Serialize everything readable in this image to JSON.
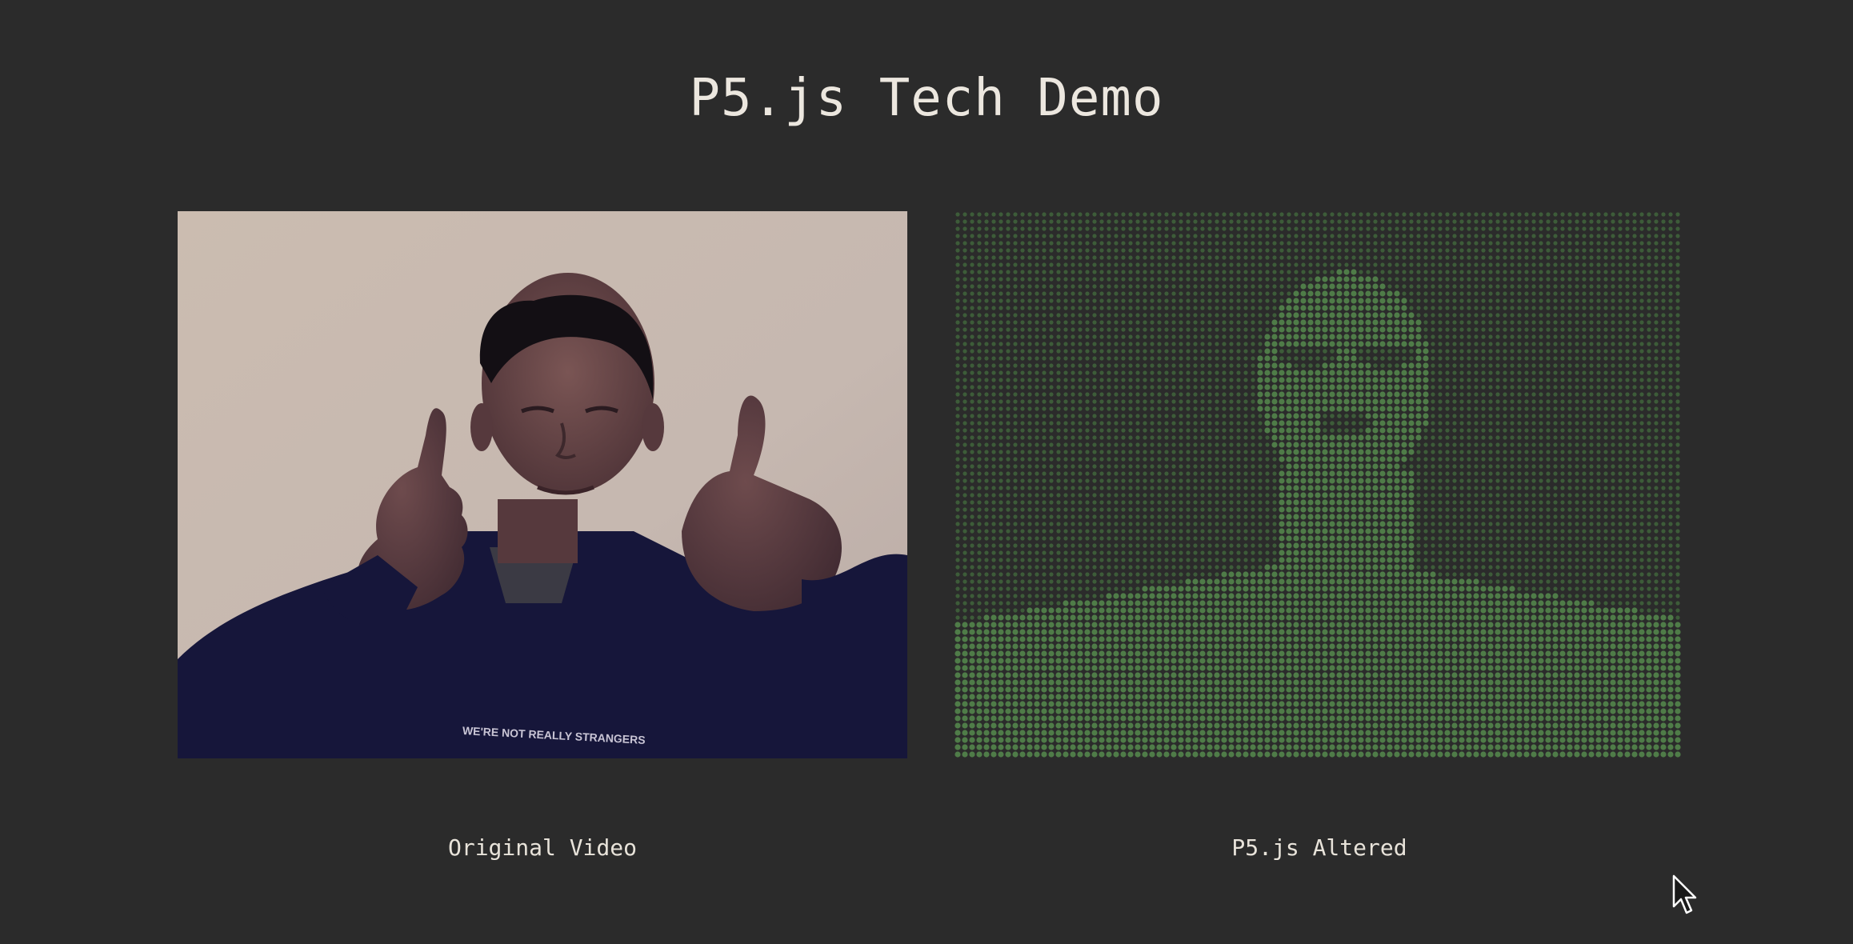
{
  "page": {
    "title": "P5.js Tech Demo"
  },
  "panels": {
    "original": {
      "caption": "Original Video",
      "shirt_text": "WE'RE NOT REALLY STRANGERS"
    },
    "altered": {
      "caption": "P5.js Altered",
      "dot_color": "#4f7c48",
      "dot_color_dark": "#3d5c39",
      "background": "#2b2b2b"
    }
  },
  "colors": {
    "background": "#2b2b2b",
    "text": "#ece7df",
    "wall": "#c5b6ad",
    "hoodie": "#171735",
    "skin": "#6b4a4e"
  },
  "icons": {
    "cursor": "cursor-arrow-icon"
  }
}
